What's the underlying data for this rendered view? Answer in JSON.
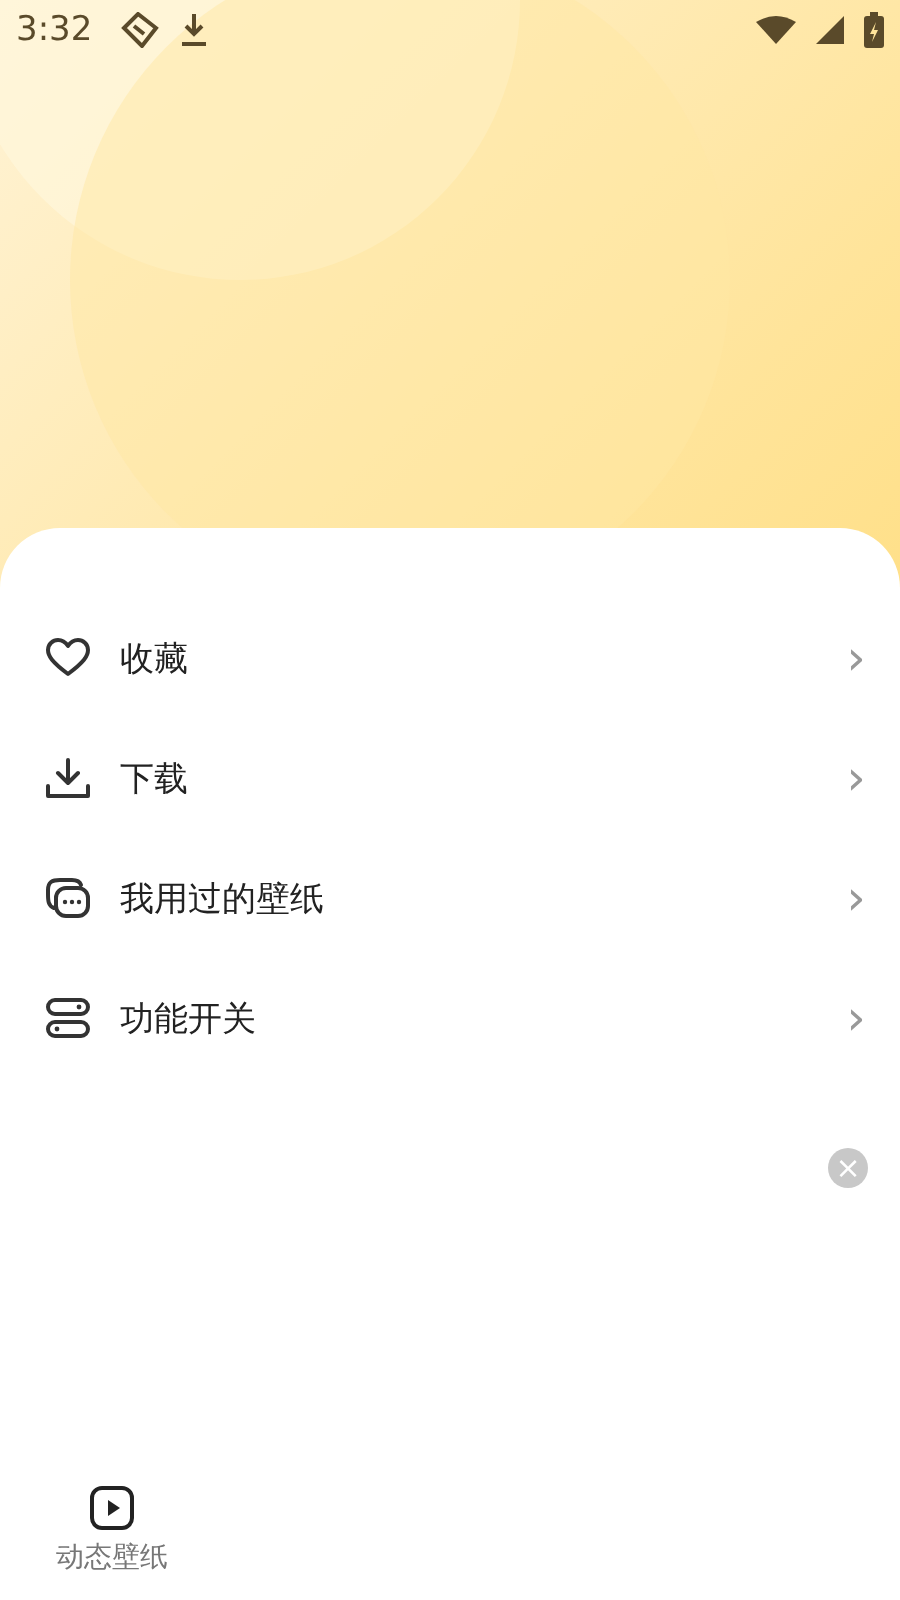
{
  "status_bar": {
    "time": "3:32"
  },
  "menu": [
    {
      "label": "收藏",
      "chevron": "›"
    },
    {
      "label": "下载",
      "chevron": "›"
    },
    {
      "label": "我用过的壁纸",
      "chevron": "›"
    },
    {
      "label": "功能开关",
      "chevron": "›"
    }
  ],
  "floating_close": {
    "label": "×"
  },
  "bottom_nav": [
    {
      "label": "动态壁纸",
      "selected": false
    }
  ]
}
